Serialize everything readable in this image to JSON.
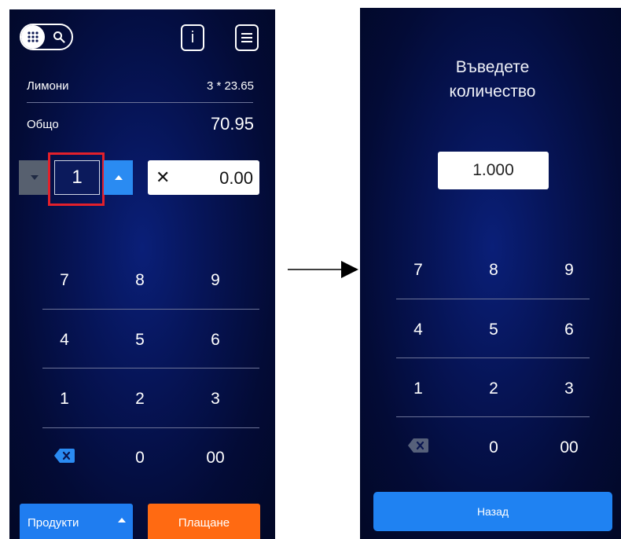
{
  "left": {
    "product_name": "Лимони",
    "product_line": "3 * 23.65",
    "total_label": "Общо",
    "total_value": "70.95",
    "quantity": "1",
    "price": "0.00",
    "price_symbol": "✕",
    "keys": [
      "7",
      "8",
      "9",
      "4",
      "5",
      "6",
      "1",
      "2",
      "3",
      "0",
      "00"
    ],
    "products_label": "Продукти",
    "pay_label": "Плащане",
    "info_label": "i"
  },
  "right": {
    "prompt_line1": "Въведете",
    "prompt_line2": "количество",
    "quantity_value": "1.000",
    "keys": [
      "7",
      "8",
      "9",
      "4",
      "5",
      "6",
      "1",
      "2",
      "3",
      "0",
      "00"
    ],
    "back_label": "Назад"
  },
  "colors": {
    "highlight": "#e3202b",
    "accent_blue": "#2a8bf2",
    "accent_orange": "#ff6a12"
  }
}
